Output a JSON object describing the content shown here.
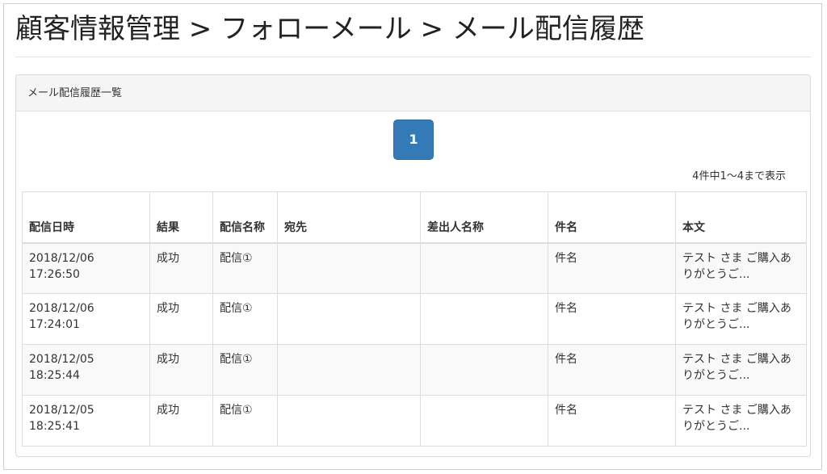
{
  "page": {
    "title": "顧客情報管理 > フォローメール > メール配信履歴"
  },
  "panel": {
    "heading": "メール配信履歴一覧"
  },
  "pagination": {
    "current_page": "1"
  },
  "summary": {
    "count_text": "4件中1〜4まで表示"
  },
  "table": {
    "headers": {
      "date": "配信日時",
      "result": "結果",
      "name": "配信名称",
      "recipient": "宛先",
      "sender": "差出人名称",
      "subject": "件名",
      "body": "本文"
    },
    "rows": [
      {
        "date": "2018/12/06 17:26:50",
        "result": "成功",
        "name": "配信①",
        "recipient": "",
        "sender": "",
        "subject": "件名",
        "body": "テスト さま ご購入ありがとうご..."
      },
      {
        "date": "2018/12/06 17:24:01",
        "result": "成功",
        "name": "配信①",
        "recipient": "",
        "sender": "",
        "subject": "件名",
        "body": "テスト さま ご購入ありがとうご..."
      },
      {
        "date": "2018/12/05 18:25:44",
        "result": "成功",
        "name": "配信①",
        "recipient": "",
        "sender": "",
        "subject": "件名",
        "body": "テスト さま ご購入ありがとうご..."
      },
      {
        "date": "2018/12/05 18:25:41",
        "result": "成功",
        "name": "配信①",
        "recipient": "",
        "sender": "",
        "subject": "件名",
        "body": "テスト さま ご購入ありがとうご..."
      }
    ]
  },
  "colors": {
    "pager_active": "#337ab7",
    "panel_heading_bg": "#f5f5f5",
    "row_stripe": "#f9f9f9"
  }
}
